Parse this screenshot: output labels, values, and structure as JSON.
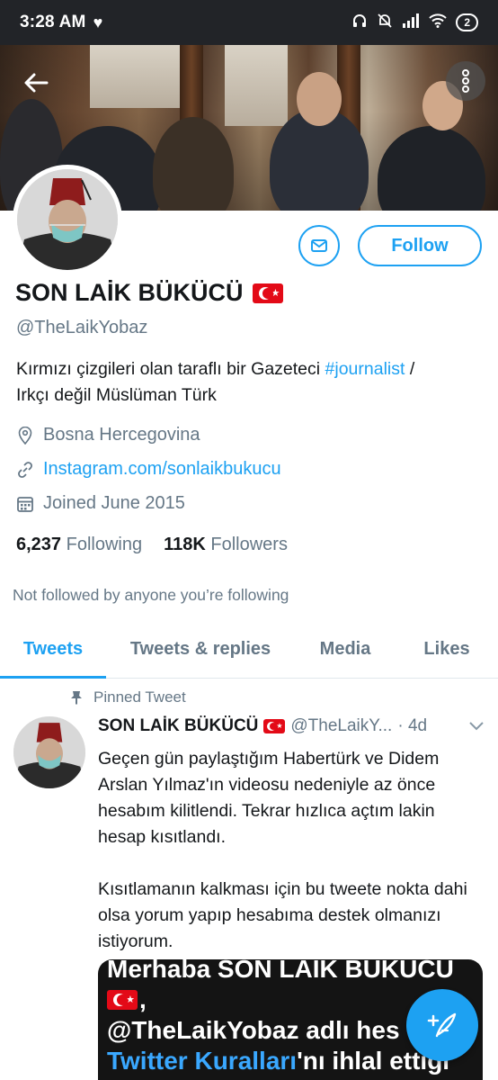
{
  "status_bar": {
    "time": "3:28 AM",
    "battery": "2"
  },
  "profile": {
    "name": "SON LAİK BÜKÜCÜ",
    "handle": "@TheLaikYobaz",
    "bio_text": "Kırmızı çizgileri olan taraflı bir Gazeteci ",
    "bio_hashtag": "#journalist",
    "bio_slash": " /",
    "bio_line2": "Irkçı değil Müslüman Türk",
    "location": "Bosna Hercegovina",
    "website": "Instagram.com/sonlaikbukucu",
    "joined": "Joined June 2015",
    "following_count": "6,237",
    "following_label": "Following",
    "followers_count": "118K",
    "followers_label": "Followers",
    "not_followed_text": "Not followed by anyone you’re following",
    "follow_label": "Follow"
  },
  "tabs": [
    {
      "label": "Tweets",
      "active": true
    },
    {
      "label": "Tweets & replies",
      "active": false
    },
    {
      "label": "Media",
      "active": false
    },
    {
      "label": "Likes",
      "active": false
    }
  ],
  "pinned_tweet": {
    "pinned_label": "Pinned Tweet",
    "name": "SON LAİK BÜKÜCÜ",
    "handle": "@TheLaikY...",
    "time": "· 4d",
    "paragraph1": "Geçen gün paylaştığım Habertürk ve Didem Arslan Yılmaz'ın videosu nedeniyle az önce hesabım kilitlendi. Tekrar hızlıca açtım lakin hesap kısıtlandı.",
    "paragraph2": "Kısıtlamanın kalkması için bu tweete nokta dahi olsa yorum yapıp hesabıma destek olmanızı istiyorum.",
    "media_line1": "Merhaba SON LAİK BÜKÜCÜ",
    "media_line2": ",",
    "media_line3": "@TheLaikYobaz adlı hes",
    "media_line4_blue": "Twitter Kuralları",
    "media_line4_rest": "'nı ihlal ettiği"
  },
  "colors": {
    "accent": "#1da1f2",
    "muted": "#657786",
    "text": "#14171a",
    "flag_red": "#e30a17"
  },
  "icons": [
    "back-arrow-icon",
    "more-vertical-icon",
    "mail-icon",
    "location-pin-icon",
    "link-icon",
    "calendar-icon",
    "pin-icon",
    "chevron-down-icon",
    "compose-tweet-icon",
    "heart-icon",
    "headphones-icon",
    "mute-bell-icon",
    "signal-icon",
    "wifi-icon"
  ]
}
